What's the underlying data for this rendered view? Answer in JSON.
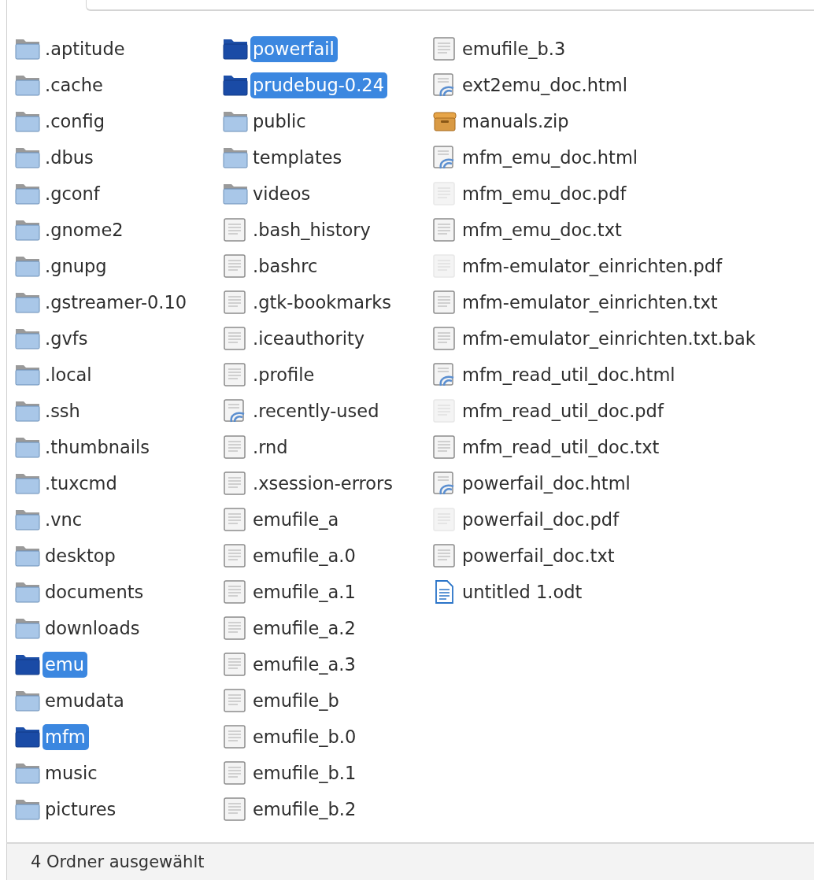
{
  "files": [
    {
      "name": ".aptitude",
      "kind": "folder",
      "selected": false
    },
    {
      "name": ".cache",
      "kind": "folder",
      "selected": false
    },
    {
      "name": ".config",
      "kind": "folder",
      "selected": false
    },
    {
      "name": ".dbus",
      "kind": "folder",
      "selected": false
    },
    {
      "name": ".gconf",
      "kind": "folder",
      "selected": false
    },
    {
      "name": ".gnome2",
      "kind": "folder",
      "selected": false
    },
    {
      "name": ".gnupg",
      "kind": "folder",
      "selected": false
    },
    {
      "name": ".gstreamer-0.10",
      "kind": "folder",
      "selected": false
    },
    {
      "name": ".gvfs",
      "kind": "folder",
      "selected": false
    },
    {
      "name": ".local",
      "kind": "folder",
      "selected": false
    },
    {
      "name": ".ssh",
      "kind": "folder",
      "selected": false
    },
    {
      "name": ".thumbnails",
      "kind": "folder",
      "selected": false
    },
    {
      "name": ".tuxcmd",
      "kind": "folder",
      "selected": false
    },
    {
      "name": ".vnc",
      "kind": "folder",
      "selected": false
    },
    {
      "name": "desktop",
      "kind": "folder",
      "selected": false
    },
    {
      "name": "documents",
      "kind": "folder",
      "selected": false
    },
    {
      "name": "downloads",
      "kind": "folder",
      "selected": false
    },
    {
      "name": "emu",
      "kind": "folder",
      "selected": true
    },
    {
      "name": "emudata",
      "kind": "folder",
      "selected": false
    },
    {
      "name": "mfm",
      "kind": "folder",
      "selected": true
    },
    {
      "name": "music",
      "kind": "folder",
      "selected": false
    },
    {
      "name": "pictures",
      "kind": "folder",
      "selected": false
    },
    {
      "name": "powerfail",
      "kind": "folder",
      "selected": true
    },
    {
      "name": "prudebug-0.24",
      "kind": "folder",
      "selected": true
    },
    {
      "name": "public",
      "kind": "folder",
      "selected": false
    },
    {
      "name": "templates",
      "kind": "folder",
      "selected": false
    },
    {
      "name": "videos",
      "kind": "folder",
      "selected": false
    },
    {
      "name": ".bash_history",
      "kind": "text",
      "selected": false
    },
    {
      "name": ".bashrc",
      "kind": "text",
      "selected": false
    },
    {
      "name": ".gtk-bookmarks",
      "kind": "text",
      "selected": false
    },
    {
      "name": ".iceauthority",
      "kind": "text",
      "selected": false
    },
    {
      "name": ".profile",
      "kind": "text",
      "selected": false
    },
    {
      "name": ".recently-used",
      "kind": "html",
      "selected": false
    },
    {
      "name": ".rnd",
      "kind": "text",
      "selected": false
    },
    {
      "name": ".xsession-errors",
      "kind": "text",
      "selected": false
    },
    {
      "name": "emufile_a",
      "kind": "text",
      "selected": false
    },
    {
      "name": "emufile_a.0",
      "kind": "text",
      "selected": false
    },
    {
      "name": "emufile_a.1",
      "kind": "text",
      "selected": false
    },
    {
      "name": "emufile_a.2",
      "kind": "text",
      "selected": false
    },
    {
      "name": "emufile_a.3",
      "kind": "text",
      "selected": false
    },
    {
      "name": "emufile_b",
      "kind": "text",
      "selected": false
    },
    {
      "name": "emufile_b.0",
      "kind": "text",
      "selected": false
    },
    {
      "name": "emufile_b.1",
      "kind": "text",
      "selected": false
    },
    {
      "name": "emufile_b.2",
      "kind": "text",
      "selected": false
    },
    {
      "name": "emufile_b.3",
      "kind": "text",
      "selected": false
    },
    {
      "name": "ext2emu_doc.html",
      "kind": "html",
      "selected": false
    },
    {
      "name": "manuals.zip",
      "kind": "archive",
      "selected": false
    },
    {
      "name": "mfm_emu_doc.html",
      "kind": "html",
      "selected": false
    },
    {
      "name": "mfm_emu_doc.pdf",
      "kind": "pdf",
      "selected": false
    },
    {
      "name": "mfm_emu_doc.txt",
      "kind": "text",
      "selected": false
    },
    {
      "name": "mfm-emulator_einrichten.pdf",
      "kind": "pdf",
      "selected": false
    },
    {
      "name": "mfm-emulator_einrichten.txt",
      "kind": "text",
      "selected": false
    },
    {
      "name": "mfm-emulator_einrichten.txt.bak",
      "kind": "text",
      "selected": false
    },
    {
      "name": "mfm_read_util_doc.html",
      "kind": "html",
      "selected": false
    },
    {
      "name": "mfm_read_util_doc.pdf",
      "kind": "pdf",
      "selected": false
    },
    {
      "name": "mfm_read_util_doc.txt",
      "kind": "text",
      "selected": false
    },
    {
      "name": "powerfail_doc.html",
      "kind": "html",
      "selected": false
    },
    {
      "name": "powerfail_doc.pdf",
      "kind": "pdf",
      "selected": false
    },
    {
      "name": "powerfail_doc.txt",
      "kind": "text",
      "selected": false
    },
    {
      "name": "untitled 1.odt",
      "kind": "document",
      "selected": false
    }
  ],
  "status_bar": "4 Ordner ausgewählt"
}
